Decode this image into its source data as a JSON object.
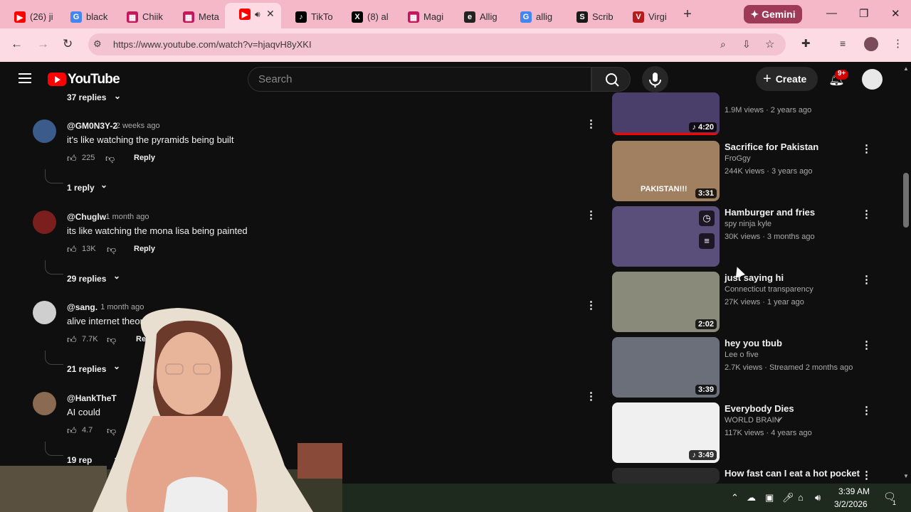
{
  "browser": {
    "tabs": [
      {
        "title": "(26) ji",
        "favicon": "youtube-icon",
        "color": "#ff0000"
      },
      {
        "title": "black",
        "favicon": "google-icon",
        "color": "#4285f4"
      },
      {
        "title": "Chiik",
        "favicon": "page-icon",
        "color": "#c2185b"
      },
      {
        "title": "Meta",
        "favicon": "page-icon",
        "color": "#c2185b"
      },
      {
        "title": "",
        "favicon": "youtube-icon",
        "color": "#ff0000",
        "active": true
      },
      {
        "title": "TikTo",
        "favicon": "tiktok-icon",
        "color": "#000000"
      },
      {
        "title": "(8) al",
        "favicon": "x-icon",
        "color": "#000000"
      },
      {
        "title": "Magi",
        "favicon": "page-icon",
        "color": "#c2185b"
      },
      {
        "title": "Allig",
        "favicon": "e-icon",
        "color": "#222222"
      },
      {
        "title": "allig",
        "favicon": "google-icon",
        "color": "#4285f4"
      },
      {
        "title": "Scrib",
        "favicon": "scribd-icon",
        "color": "#1a1a1a"
      },
      {
        "title": "Virgi",
        "favicon": "v-icon",
        "color": "#b71c1c"
      }
    ],
    "gemini_label": "Gemini",
    "url": "https://www.youtube.com/watch?v=hjaqvH8yXKI"
  },
  "youtube": {
    "logo_text": "YouTube",
    "search_placeholder": "Search",
    "create_label": "Create",
    "notif_badge": "9+"
  },
  "comments": {
    "partial_top_replies": "37 replies",
    "items": [
      {
        "author": "@GM0N3Y-2",
        "time": "2 weeks ago",
        "text": "it's like watching the pyramids being built",
        "likes": "225",
        "reply": "Reply",
        "replies": "1 reply"
      },
      {
        "author": "@Chuglw",
        "time": "1 month ago",
        "text": "its like watching the mona lisa being painted",
        "likes": "13K",
        "reply": "Reply",
        "replies": "29 replies"
      },
      {
        "author": "@sang.",
        "time": "1 month ago",
        "text": "alive internet theory",
        "likes": "7.7K",
        "reply": "Re",
        "replies": "21 replies"
      },
      {
        "author": "@HankTheT",
        "time": "",
        "text": "AI could",
        "likes": "4.7",
        "reply": "",
        "replies": "19 rep"
      }
    ]
  },
  "recommendations": [
    {
      "title": "",
      "channel": "",
      "meta": "1.9M views · 2 years ago",
      "duration": "4:20",
      "music": true
    },
    {
      "title": "Sacrifice for Pakistan",
      "channel": "FroGgy",
      "meta": "244K views · 3 years ago",
      "duration": "3:31",
      "thumb_text": "PAKISTAN!!!"
    },
    {
      "title": "Hamburger and fries",
      "channel": "spy ninja kyle",
      "meta": "30K views · 3 months ago",
      "duration": ""
    },
    {
      "title": "just saying hi",
      "channel": "Connecticut transparency",
      "meta": "27K views · 1 year ago",
      "duration": "2:02"
    },
    {
      "title": "hey you tbub",
      "channel": "Lee o five",
      "meta": "2.7K views · Streamed 2 months ago",
      "duration": "3:39"
    },
    {
      "title": "Everybody Dies",
      "channel": "WORLD BRAIN",
      "meta": "117K views · 4 years ago",
      "duration": "3:49",
      "music": true,
      "verified": true
    },
    {
      "title": "How fast can I eat a hot pocket",
      "channel": "",
      "meta": "",
      "duration": ""
    }
  ],
  "taskbar": {
    "time": "3:39 AM",
    "date": "3/2/2026",
    "notif_count": "1"
  }
}
